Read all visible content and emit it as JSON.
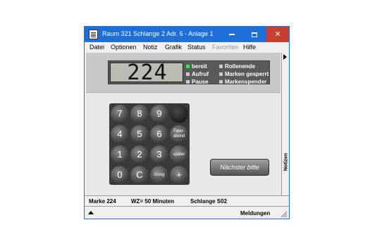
{
  "window": {
    "title": "Raum 321 Schlange 2 Adr. 6 - Anlage 1"
  },
  "menu": {
    "items": [
      {
        "label": "Datei"
      },
      {
        "label": "Optionen"
      },
      {
        "label": "Notiz"
      },
      {
        "label": "Grafik"
      },
      {
        "label": "Status"
      },
      {
        "label": "Favoriten",
        "disabled": true
      },
      {
        "label": "Hilfe"
      }
    ]
  },
  "display": {
    "number": "224",
    "indicators": [
      {
        "label": "bereit",
        "active": true
      },
      {
        "label": "Rollenende",
        "active": false
      },
      {
        "label": "Aufruf",
        "active": false
      },
      {
        "label": "Marken gesperrt",
        "active": false
      },
      {
        "label": "Pause",
        "active": false
      },
      {
        "label": "Markenspender",
        "active": false
      }
    ]
  },
  "keypad": {
    "keys": [
      {
        "label": "7"
      },
      {
        "label": "8"
      },
      {
        "label": "9"
      },
      {
        "label": ""
      },
      {
        "label": "4"
      },
      {
        "label": "5"
      },
      {
        "label": "6"
      },
      {
        "label": "Feier-abend"
      },
      {
        "label": "1"
      },
      {
        "label": "2"
      },
      {
        "label": "3"
      },
      {
        "label": "später"
      },
      {
        "label": "0"
      },
      {
        "label": "C"
      },
      {
        "label": "Gong"
      },
      {
        "label": "+"
      }
    ]
  },
  "next_button": {
    "label": "Nächster bitte"
  },
  "side_panel": {
    "label": "Notizen"
  },
  "statusbar": {
    "marke": "Marke 224",
    "wait": "WZ= 50 Minuten",
    "queue": "Schlange S02"
  },
  "messages": {
    "label": "Meldungen"
  },
  "colors": {
    "titlebar": "#1e6fd9",
    "close": "#c7402f",
    "led_on": "#2ee84a"
  }
}
